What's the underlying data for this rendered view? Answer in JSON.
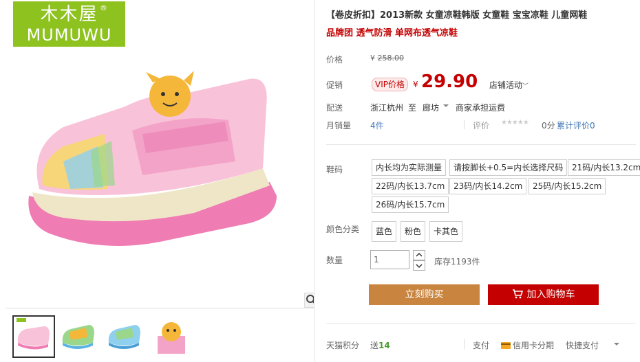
{
  "brand": {
    "logo_cn": "木木屋",
    "logo_en": "MUMUWU",
    "logo_reg": "®",
    "color": "#8dc21f"
  },
  "product": {
    "title": "【卷皮折扣】2013新款 女童凉鞋韩版 女童鞋 宝宝凉鞋 儿童网鞋",
    "subtitle": "品牌团 透气防滑 单网布透气凉鞋"
  },
  "price": {
    "label": "价格",
    "original_symbol": "¥",
    "original": "258.00",
    "promo_label": "促销",
    "vip_label": "VIP价格",
    "symbol": "¥",
    "current": "29.90",
    "activity": "店铺活动",
    "accent_color": "#c40000"
  },
  "shipping": {
    "label": "配送",
    "from": "浙江杭州",
    "to_word": "至",
    "dest": "廊坊",
    "fee": "商家承担运费"
  },
  "sales": {
    "label": "月销量",
    "count": "4",
    "unit": "件",
    "review_label": "评价",
    "stars": "★★★★★",
    "score": "0分",
    "total_reviews": "累计评价0"
  },
  "size": {
    "label": "鞋码",
    "options": [
      "内长均为实际测量",
      "请按脚长+0.5=内长选择尺码",
      "21码/内长13.2cm",
      "22码/内长13.7cm",
      "23码/内长14.2cm",
      "25码/内长15.2cm",
      "26码/内长15.7cm"
    ]
  },
  "color": {
    "label": "颜色分类",
    "options": [
      "蓝色",
      "粉色",
      "卡其色"
    ]
  },
  "quantity": {
    "label": "数量",
    "value": "1",
    "stock": "库存1193件"
  },
  "buttons": {
    "buy": "立刻购买",
    "cart": "加入购物车",
    "buy_color": "#c9853f",
    "cart_color": "#c40000"
  },
  "footer": {
    "points_label": "天猫积分",
    "points_prefix": "送",
    "points_value": "14",
    "pay_label": "支付",
    "credit": "信用卡分期",
    "quick": "快捷支付"
  },
  "icons": {
    "zoom": "magnifier-icon",
    "cart": "cart-icon",
    "card": "credit-card-icon"
  }
}
